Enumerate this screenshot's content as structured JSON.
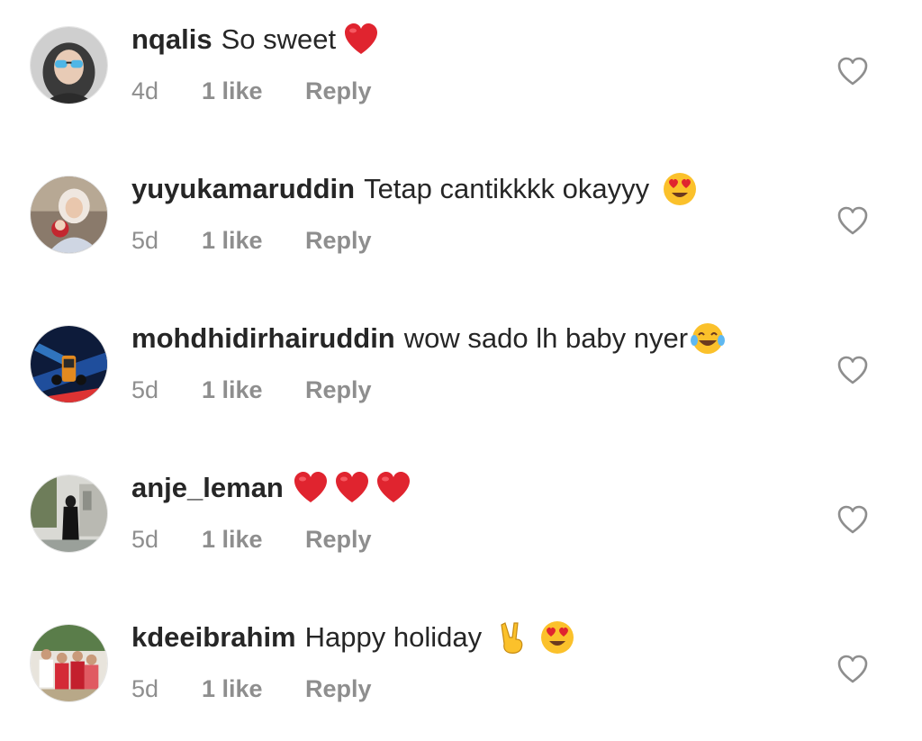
{
  "comments": [
    {
      "username": "nqalis",
      "text": "So sweet",
      "emojis": [
        "red-heart"
      ],
      "time": "4d",
      "likes": "1 like",
      "reply_label": "Reply",
      "avatar": "avatar-hijab-sunglasses"
    },
    {
      "username": "yuyukamaruddin",
      "text": "Tetap cantikkkk okayyy",
      "emojis": [
        "heart-eyes"
      ],
      "time": "5d",
      "likes": "1 like",
      "reply_label": "Reply",
      "avatar": "avatar-woman-with-baby"
    },
    {
      "username": "mohdhidirhairuddin",
      "text": "wow sado lh baby nyer",
      "emojis": [
        "tears-of-joy"
      ],
      "time": "5d",
      "likes": "1 like",
      "reply_label": "Reply",
      "avatar": "avatar-race-car"
    },
    {
      "username": "anje_leman",
      "text": "",
      "emojis": [
        "red-heart",
        "red-heart",
        "red-heart"
      ],
      "time": "5d",
      "likes": "1 like",
      "reply_label": "Reply",
      "avatar": "avatar-woman-standing"
    },
    {
      "username": "kdeeibrahim",
      "text": "Happy holiday",
      "emojis": [
        "victory-hand",
        "heart-eyes"
      ],
      "time": "5d",
      "likes": "1 like",
      "reply_label": "Reply",
      "avatar": "avatar-group-photo"
    }
  ],
  "colors": {
    "text": "#262626",
    "secondary": "#8e8e8e",
    "heart_red": "#e0242f",
    "background": "#ffffff"
  },
  "icons": {
    "like_button": "heart-outline-icon"
  }
}
